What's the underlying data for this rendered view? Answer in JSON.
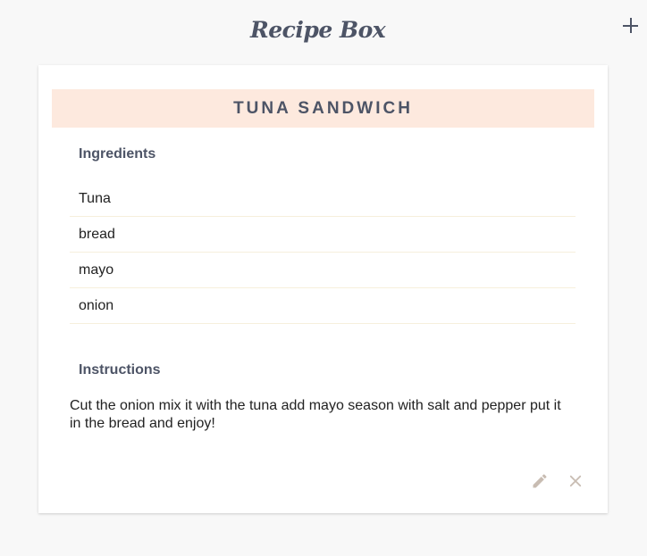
{
  "app": {
    "title": "Recipe Box",
    "add_icon": "plus-icon"
  },
  "recipe": {
    "title": "TUNA SANDWICH",
    "ingredients_label": "Ingredients",
    "ingredients": [
      "Tuna",
      "bread",
      "mayo",
      "onion"
    ],
    "instructions_label": "Instructions",
    "instructions": "Cut the onion mix it with the tuna add mayo season with salt and pepper put it in the bread and enjoy!"
  },
  "actions": {
    "edit_icon": "pencil-icon",
    "delete_icon": "close-icon"
  },
  "colors": {
    "header_bg": "#fde9de",
    "text_dark": "#4d5466",
    "icon_muted": "#c8bcb2",
    "divider": "#f6efdc"
  }
}
